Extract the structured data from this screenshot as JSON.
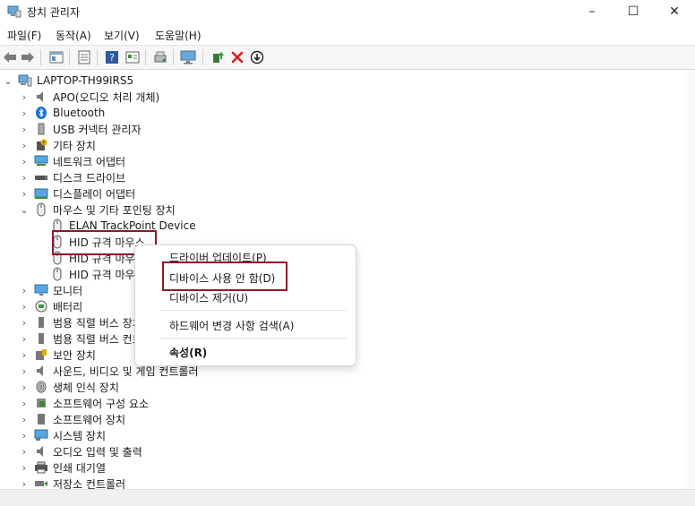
{
  "window": {
    "title": "장치 관리자",
    "minimize": "–",
    "maximize": "☐",
    "close": "✕"
  },
  "menubar": [
    "파일(F)",
    "동작(A)",
    "보기(V)",
    "도움말(H)"
  ],
  "toolbar": [
    "back-arrow-icon",
    "forward-arrow-icon",
    "properties-icon",
    "list-icon",
    "help-icon",
    "view-icon",
    "scan-icon",
    "monitor-icon",
    "update-driver-icon",
    "uninstall-x-icon",
    "disable-down-icon"
  ],
  "tree": {
    "root": "LAPTOP-TH99IRS5",
    "items": [
      {
        "label": "APO(오디오 처리 개체)",
        "icon": "speaker-icon",
        "expanded": false
      },
      {
        "label": "Bluetooth",
        "icon": "bluetooth-icon",
        "expanded": false
      },
      {
        "label": "USB 커넥터 관리자",
        "icon": "usb-icon",
        "expanded": false
      },
      {
        "label": "기타 장치",
        "icon": "unknown-device-icon",
        "expanded": false
      },
      {
        "label": "네트워크 어댑터",
        "icon": "network-icon",
        "expanded": false
      },
      {
        "label": "디스크 드라이브",
        "icon": "disk-icon",
        "expanded": false
      },
      {
        "label": "디스플레이 어댑터",
        "icon": "display-icon",
        "expanded": false
      },
      {
        "label": "마우스 및 기타 포인팅 장치",
        "icon": "mouse-icon",
        "expanded": true,
        "children": [
          "ELAN TrackPoint Device",
          "HID 규격 마우스",
          "HID 규격 마우스",
          "HID 규격 마우스"
        ]
      },
      {
        "label": "모니터",
        "icon": "monitor-icon",
        "expanded": false
      },
      {
        "label": "배터리",
        "icon": "battery-icon",
        "expanded": false
      },
      {
        "label": "범용 직렬 버스 장치",
        "icon": "usb-device-icon",
        "expanded": false
      },
      {
        "label": "범용 직렬 버스 컨트롤러",
        "icon": "usb-controller-icon",
        "expanded": false
      },
      {
        "label": "보안 장치",
        "icon": "security-icon",
        "expanded": false
      },
      {
        "label": "사운드, 비디오 및 게임 컨트롤러",
        "icon": "sound-icon",
        "expanded": false
      },
      {
        "label": "생체 인식 장치",
        "icon": "fingerprint-icon",
        "expanded": false
      },
      {
        "label": "소프트웨어 구성 요소",
        "icon": "software-component-icon",
        "expanded": false
      },
      {
        "label": "소프트웨어 장치",
        "icon": "software-device-icon",
        "expanded": false
      },
      {
        "label": "시스템 장치",
        "icon": "system-icon",
        "expanded": false
      },
      {
        "label": "오디오 입력 및 출력",
        "icon": "audio-io-icon",
        "expanded": false
      },
      {
        "label": "인쇄 대기열",
        "icon": "printer-icon",
        "expanded": false
      },
      {
        "label": "저장소 컨트롤러",
        "icon": "storage-icon",
        "expanded": false
      }
    ]
  },
  "context_menu": {
    "items": [
      "드라이버 업데이트(P)",
      "디바이스 사용 안 함(D)",
      "디바이스 제거(U)",
      "하드웨어 변경 사항 검색(A)",
      "속성(R)"
    ]
  },
  "colors": {
    "accent": "#8b1a2b",
    "selection": "#cce4f7"
  }
}
